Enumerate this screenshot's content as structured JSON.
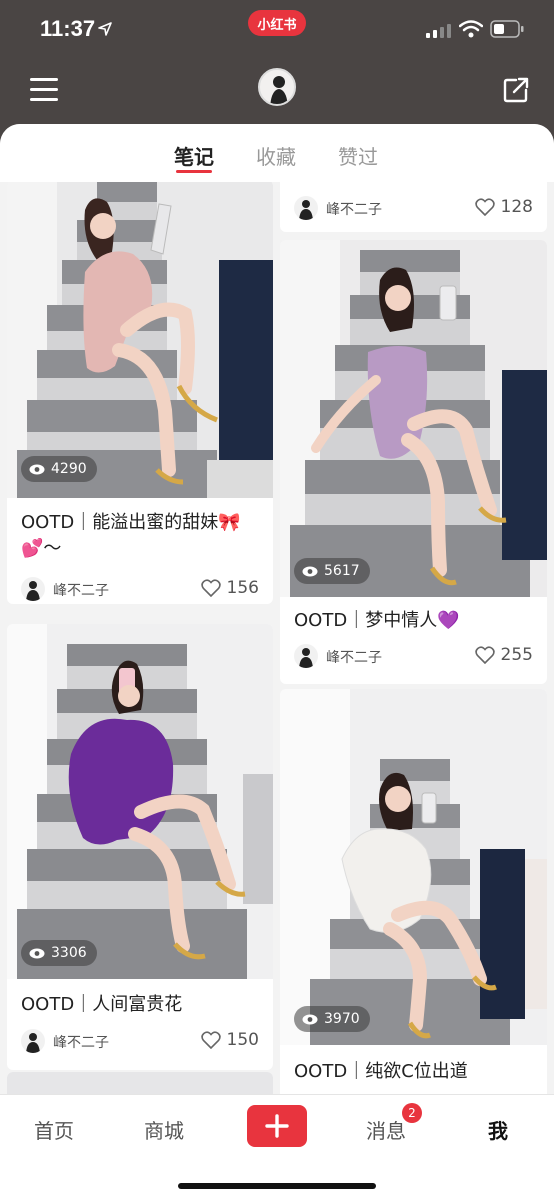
{
  "status_bar": {
    "time": "11:37",
    "app_label": "小红书"
  },
  "tabs": [
    {
      "label": "笔记",
      "active": true
    },
    {
      "label": "收藏",
      "active": false
    },
    {
      "label": "赞过",
      "active": false
    }
  ],
  "author_name": "峰不二子",
  "cards_left": [
    {
      "views": "4290",
      "title": "OOTD｜能溢出蜜的甜妹🎀💕～",
      "likes": "156",
      "dress_color": "#e3b7b3"
    },
    {
      "views": "3306",
      "title": "OOTD｜人间富贵花",
      "likes": "150",
      "dress_color": "#6b2c9a"
    }
  ],
  "cards_right": [
    {
      "views": "",
      "title": "",
      "likes": "128"
    },
    {
      "views": "5617",
      "title": "OOTD｜梦中情人💜",
      "likes": "255",
      "dress_color": "#b89ac4"
    },
    {
      "views": "3970",
      "title": "OOTD｜纯欲C位出道",
      "likes": "",
      "dress_color": "#f2f0ed"
    }
  ],
  "bottom_nav": {
    "home": "首页",
    "mall": "商城",
    "messages": "消息",
    "messages_badge": "2",
    "me": "我"
  },
  "colors": {
    "accent": "#e8343e",
    "header_bg": "#4a4544"
  }
}
